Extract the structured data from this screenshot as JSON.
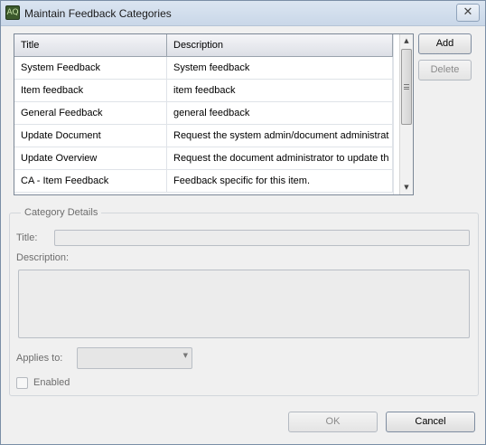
{
  "window": {
    "title": "Maintain Feedback Categories",
    "app_icon": "AQ",
    "close_glyph": "✕"
  },
  "table": {
    "columns": [
      "Title",
      "Description"
    ],
    "rows": [
      {
        "title": "System Feedback",
        "description": "System feedback"
      },
      {
        "title": "Item feedback",
        "description": "item feedback"
      },
      {
        "title": "General Feedback",
        "description": "general feedback"
      },
      {
        "title": "Update Document",
        "description": "Request the system admin/document administrat"
      },
      {
        "title": "Update Overview",
        "description": "Request the document administrator to update th"
      },
      {
        "title": "CA - Item Feedback",
        "description": "Feedback specific for this item."
      }
    ],
    "scroll_up_glyph": "▲",
    "scroll_down_glyph": "▼"
  },
  "buttons": {
    "add": "Add",
    "delete": "Delete",
    "ok": "OK",
    "cancel": "Cancel"
  },
  "details": {
    "legend": "Category Details",
    "title_label": "Title:",
    "title_value": "",
    "description_label": "Description:",
    "description_value": "",
    "applies_label": "Applies to:",
    "applies_value": "",
    "combo_arrow": "▼",
    "enabled_label": "Enabled",
    "enabled_checked": false
  }
}
